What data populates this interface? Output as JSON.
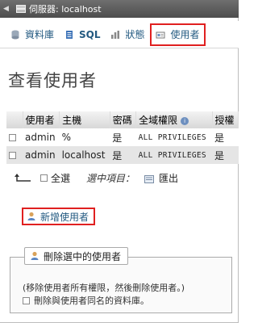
{
  "server_bar": {
    "label": "伺服器: localhost"
  },
  "tabs": [
    {
      "label": "資料庫",
      "icon": "database-icon"
    },
    {
      "label": "SQL",
      "icon": "sql-icon"
    },
    {
      "label": "狀態",
      "icon": "status-icon"
    },
    {
      "label": "使用者",
      "icon": "users-icon",
      "active": true
    }
  ],
  "page_title": "查看使用者",
  "table": {
    "headers": [
      "使用者",
      "主機",
      "密碼",
      "全域權限",
      "授權"
    ],
    "rows": [
      {
        "user": "admin",
        "host": "%",
        "password": "是",
        "privileges": "ALL PRIVILEGES",
        "grant": "是"
      },
      {
        "user": "admin",
        "host": "localhost",
        "password": "是",
        "privileges": "ALL PRIVILEGES",
        "grant": "是"
      }
    ]
  },
  "actions": {
    "select_all": "全選",
    "with_selected": "選中項目：",
    "export": "匯出"
  },
  "add_user": {
    "label": "新增使用者"
  },
  "delete": {
    "legend": "刪除選中的使用者",
    "note": "(移除使用者所有權限，然後刪除使用者。)",
    "drop_db_label": "刪除與使用者同名的資料庫。"
  },
  "colors": {
    "accent_red": "#e02020",
    "link_blue": "#235a81"
  }
}
